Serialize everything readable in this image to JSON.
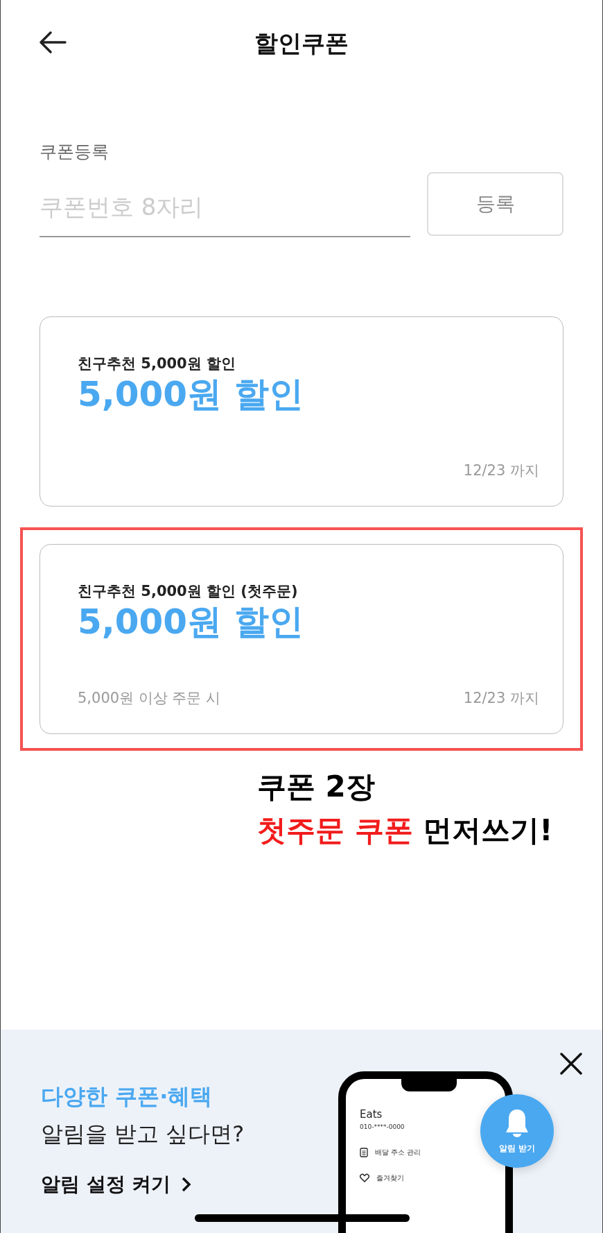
{
  "header": {
    "title": "할인쿠폰"
  },
  "register": {
    "label": "쿠폰등록",
    "placeholder": "쿠폰번호 8자리",
    "button": "등록"
  },
  "coupons": [
    {
      "name": "친구추천 5,000원 할인",
      "amount": "5,000원 할인",
      "date": "12/23 까지",
      "highlighted": false
    },
    {
      "name": "친구추천 5,000원 할인 (첫주문)",
      "amount": "5,000원 할인",
      "condition": "5,000원 이상 주문 시",
      "date": "12/23 까지",
      "highlighted": true
    }
  ],
  "annotation": {
    "lines": [
      [
        {
          "text": "쿠폰 2장",
          "emphasis": false
        }
      ],
      [
        {
          "text": "첫주문 쿠폰",
          "emphasis": true
        },
        {
          "text": " 먼저쓰기!",
          "emphasis": false
        }
      ]
    ]
  },
  "banner": {
    "headline": "다양한 쿠폰·혜택",
    "subline": "알림을 받고 싶다면?",
    "link": "알림 설정 켜기",
    "phone": {
      "name": "Eats",
      "phone": "010-****-0000",
      "menu": [
        {
          "kind": "list",
          "label": "배달 주소 관리"
        },
        {
          "kind": "heart",
          "label": "즐겨찾기"
        }
      ]
    },
    "bell_label": "알림 받기"
  }
}
